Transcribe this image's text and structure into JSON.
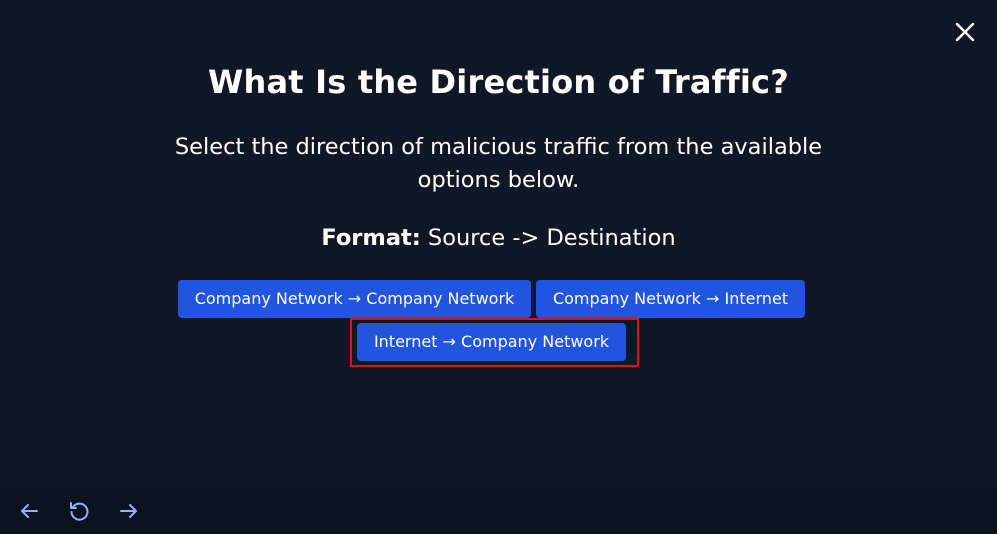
{
  "modal": {
    "title": "What Is the Direction of Traffic?",
    "subtitle": "Select the direction of malicious traffic from the available options below.",
    "format_label": "Format:",
    "format_value": " Source -> Destination"
  },
  "options": [
    {
      "label": "Company Network → Company Network"
    },
    {
      "label": "Company Network → Internet"
    },
    {
      "label": "Internet → Company Network",
      "highlighted": true
    }
  ],
  "icons": {
    "close": "close-icon",
    "back": "arrow-left-icon",
    "reload": "reload-icon",
    "forward": "arrow-right-icon"
  },
  "colors": {
    "background": "#101828",
    "bottom_bar": "#0b1220",
    "button": "#2155e0",
    "highlight": "#e0101a",
    "nav_icon": "#8fb4ff"
  }
}
